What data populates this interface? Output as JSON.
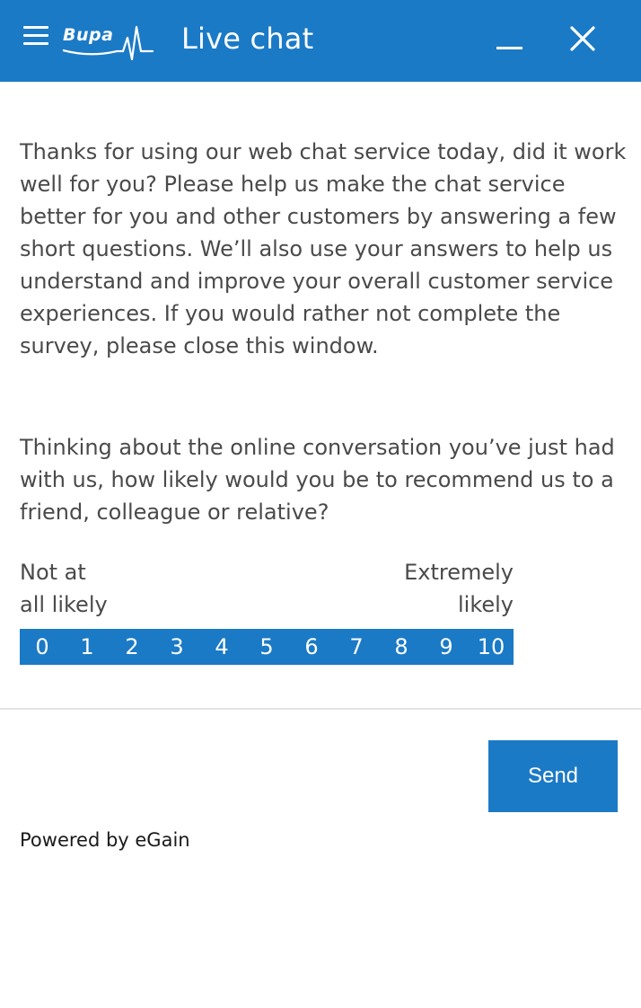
{
  "header": {
    "logo_text": "Bupa",
    "title": "Live chat",
    "icons": {
      "menu": "hamburger-menu-icon",
      "minimize": "minimize-icon",
      "close": "close-icon"
    },
    "background_color": "#1b7ac6"
  },
  "survey": {
    "intro": "Thanks for using our web chat service today, did it work well for you? Please help us make the chat service better for you and other customers by answering a few short questions. We’ll also use your answers to help us understand and improve your overall customer service experiences. If you would rather not complete the survey, please close this window.",
    "question": "Thinking about the online conversation you’ve just had with us, how likely would you be to recommend us to a friend, colleague or relative?",
    "scale_low_label_line1": "Not at",
    "scale_low_label_line2": "all likely",
    "scale_high_label_line1": "Extremely",
    "scale_high_label_line2": "likely",
    "scale_options": [
      "0",
      "1",
      "2",
      "3",
      "4",
      "5",
      "6",
      "7",
      "8",
      "9",
      "10"
    ]
  },
  "footer": {
    "send_label": "Send",
    "powered_by": "Powered by eGain"
  },
  "colors": {
    "accent": "#1b7ac6",
    "text": "#4a4a4a",
    "divider": "#e3e3e3"
  }
}
